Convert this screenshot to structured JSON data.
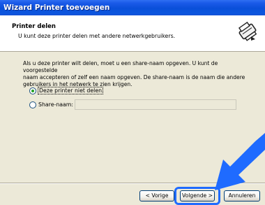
{
  "window": {
    "title": "Wizard Printer toevoegen"
  },
  "header": {
    "title": "Printer delen",
    "subtitle": "U kunt deze printer delen met andere netwerkgebruikers.",
    "icon": "printer-share-icon"
  },
  "body": {
    "line1": "Als u deze printer wilt delen, moet u een share-naam opgeven. U kunt de voorgestelde",
    "line2": "naam accepteren of zelf een naam opgeven. De share-naam is de naam die andere",
    "line3": "gebruikers in het netwerk te zien krijgen."
  },
  "options": {
    "not_share_label": "Deze printer niet delen",
    "not_share_selected": true,
    "share_label": "Share-naam:",
    "share_selected": false,
    "share_name_value": ""
  },
  "buttons": {
    "back": "< Vorige",
    "next": "Volgende >",
    "cancel": "Annuleren"
  },
  "colors": {
    "titlebar": "#0a4fd9",
    "highlight": "#1f6bff",
    "arrow": "#1f6bff"
  }
}
